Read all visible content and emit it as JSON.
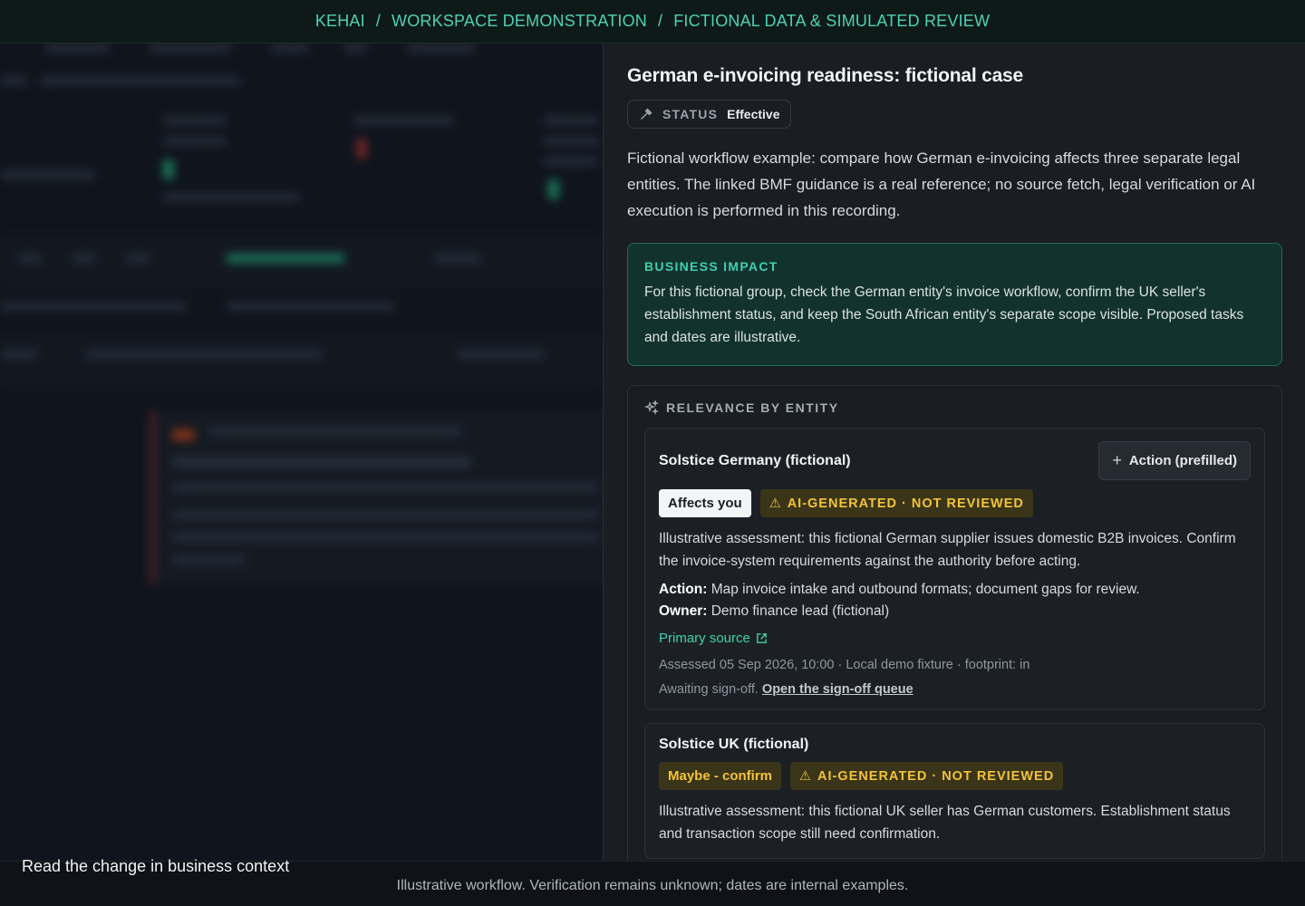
{
  "breadcrumb": {
    "items": [
      "KEHAI",
      "WORKSPACE DEMONSTRATION",
      "FICTIONAL DATA & SIMULATED REVIEW"
    ],
    "separator": "/"
  },
  "panel": {
    "title": "German e-invoicing readiness: fictional case",
    "status_label": "STATUS",
    "status_value": "Effective",
    "description": "Fictional workflow example: compare how German e-invoicing affects three separate legal entities. The linked BMF guidance is a real reference; no source fetch, legal verification or AI execution is performed in this recording.",
    "business_impact": {
      "title": "BUSINESS IMPACT",
      "text": "For this fictional group, check the German entity's invoice workflow, confirm the UK seller's establishment status, and keep the South African entity's separate scope visible. Proposed tasks and dates are illustrative."
    },
    "relevance": {
      "title": "RELEVANCE BY ENTITY",
      "entities": [
        {
          "name": "Solstice Germany (fictional)",
          "action_button": "Action (prefilled)",
          "relevance_badge": "Affects you",
          "ai_badge": "AI-GENERATED · NOT REVIEWED",
          "assessment": "Illustrative assessment: this fictional German supplier issues domestic B2B invoices. Confirm the invoice-system requirements against the authority before acting.",
          "action_label": "Action:",
          "action_text": "Map invoice intake and outbound formats; document gaps for review.",
          "owner_label": "Owner:",
          "owner_text": "Demo finance lead (fictional)",
          "source_link": "Primary source",
          "meta": "Assessed 05 Sep 2026, 10:00 · Local demo fixture · footprint: in",
          "signoff_text": "Awaiting sign-off.",
          "signoff_link": "Open the sign-off queue"
        },
        {
          "name": "Solstice UK (fictional)",
          "relevance_badge": "Maybe - confirm",
          "ai_badge": "AI-GENERATED · NOT REVIEWED",
          "assessment": "Illustrative assessment: this fictional UK seller has German customers. Establishment status and transaction scope still need confirmation."
        }
      ]
    }
  },
  "captions": {
    "left": "Read the change in business context",
    "center": "Illustrative workflow. Verification remains unknown; dates are internal examples."
  },
  "colors": {
    "accent": "#3fd0ad",
    "warning": "#f3c33a",
    "impact_bg": "#12322d"
  }
}
